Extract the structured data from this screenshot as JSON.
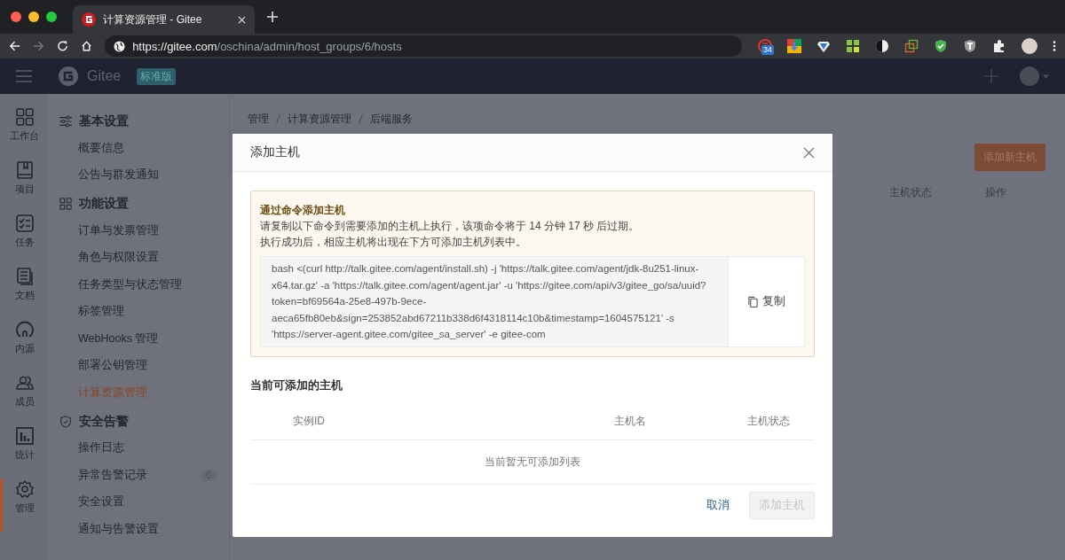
{
  "browser": {
    "tab_title": "计算资源管理 - Gitee",
    "url_host": "https://gitee.com",
    "url_path": "/oschina/admin/host_groups/6/hosts",
    "extension_badge": "34"
  },
  "app_header": {
    "brand": "Gitee",
    "edition": "标准版"
  },
  "rail": [
    {
      "label": "工作台",
      "selected": false
    },
    {
      "label": "项目",
      "selected": false
    },
    {
      "label": "任务",
      "selected": false
    },
    {
      "label": "文档",
      "selected": false
    },
    {
      "label": "内源",
      "selected": false
    },
    {
      "label": "成员",
      "selected": false
    },
    {
      "label": "统计",
      "selected": false
    },
    {
      "label": "管理",
      "selected": true
    }
  ],
  "sidebar": [
    {
      "title": "基本设置",
      "items": [
        {
          "label": "概要信息",
          "selected": false
        },
        {
          "label": "公告与群发通知",
          "selected": false
        }
      ]
    },
    {
      "title": "功能设置",
      "items": [
        {
          "label": "订单与发票管理",
          "selected": false
        },
        {
          "label": "角色与权限设置",
          "selected": false
        },
        {
          "label": "任务类型与状态管理",
          "selected": false
        },
        {
          "label": "标签管理",
          "selected": false
        },
        {
          "label": "WebHooks 管理",
          "selected": false
        },
        {
          "label": "部署公钥管理",
          "selected": false
        },
        {
          "label": "计算资源管理",
          "selected": true
        }
      ]
    },
    {
      "title": "安全告警",
      "items": [
        {
          "label": "操作日志",
          "selected": false
        },
        {
          "label": "异常告警记录",
          "selected": false,
          "badge": "0"
        },
        {
          "label": "安全设置",
          "selected": false
        },
        {
          "label": "通知与告警设置",
          "selected": false
        }
      ]
    }
  ],
  "breadcrumb": [
    "管理",
    "计算资源管理",
    "后端服务"
  ],
  "page": {
    "add_button": "添加新主机",
    "table_columns": [
      "主机状态",
      "操作"
    ]
  },
  "modal": {
    "title": "添加主机",
    "notice": {
      "title": "通过命令添加主机",
      "lines": [
        "请复制以下命令到需要添加的主机上执行，该项命令将于 14 分钟 17 秒 后过期。",
        "执行成功后，相应主机将出现在下方可添加主机列表中。"
      ]
    },
    "command": "bash <(curl http://talk.gitee.com/agent/install.sh) -j 'https://talk.gitee.com/agent/jdk-8u251-linux-x64.tar.gz' -a 'https://talk.gitee.com/agent/agent.jar' -u 'https://gitee.com/api/v3/gitee_go/sa/uuid?token=bf69564a-25e8-497b-9ece-aeca65fb80eb&sign=253852abd67211b338d6f4318114c10b&timestamp=1604575121' -s 'https://server-agent.gitee.com/gitee_sa_server' -e gitee-com",
    "copy_button": "复制",
    "section_title": "当前可添加的主机",
    "table_columns": [
      "实例ID",
      "主机名",
      "主机状态"
    ],
    "empty_text": "当前暂无可添加列表",
    "cancel_button": "取消",
    "confirm_button": {
      "label": "添加主机",
      "disabled": true
    }
  }
}
